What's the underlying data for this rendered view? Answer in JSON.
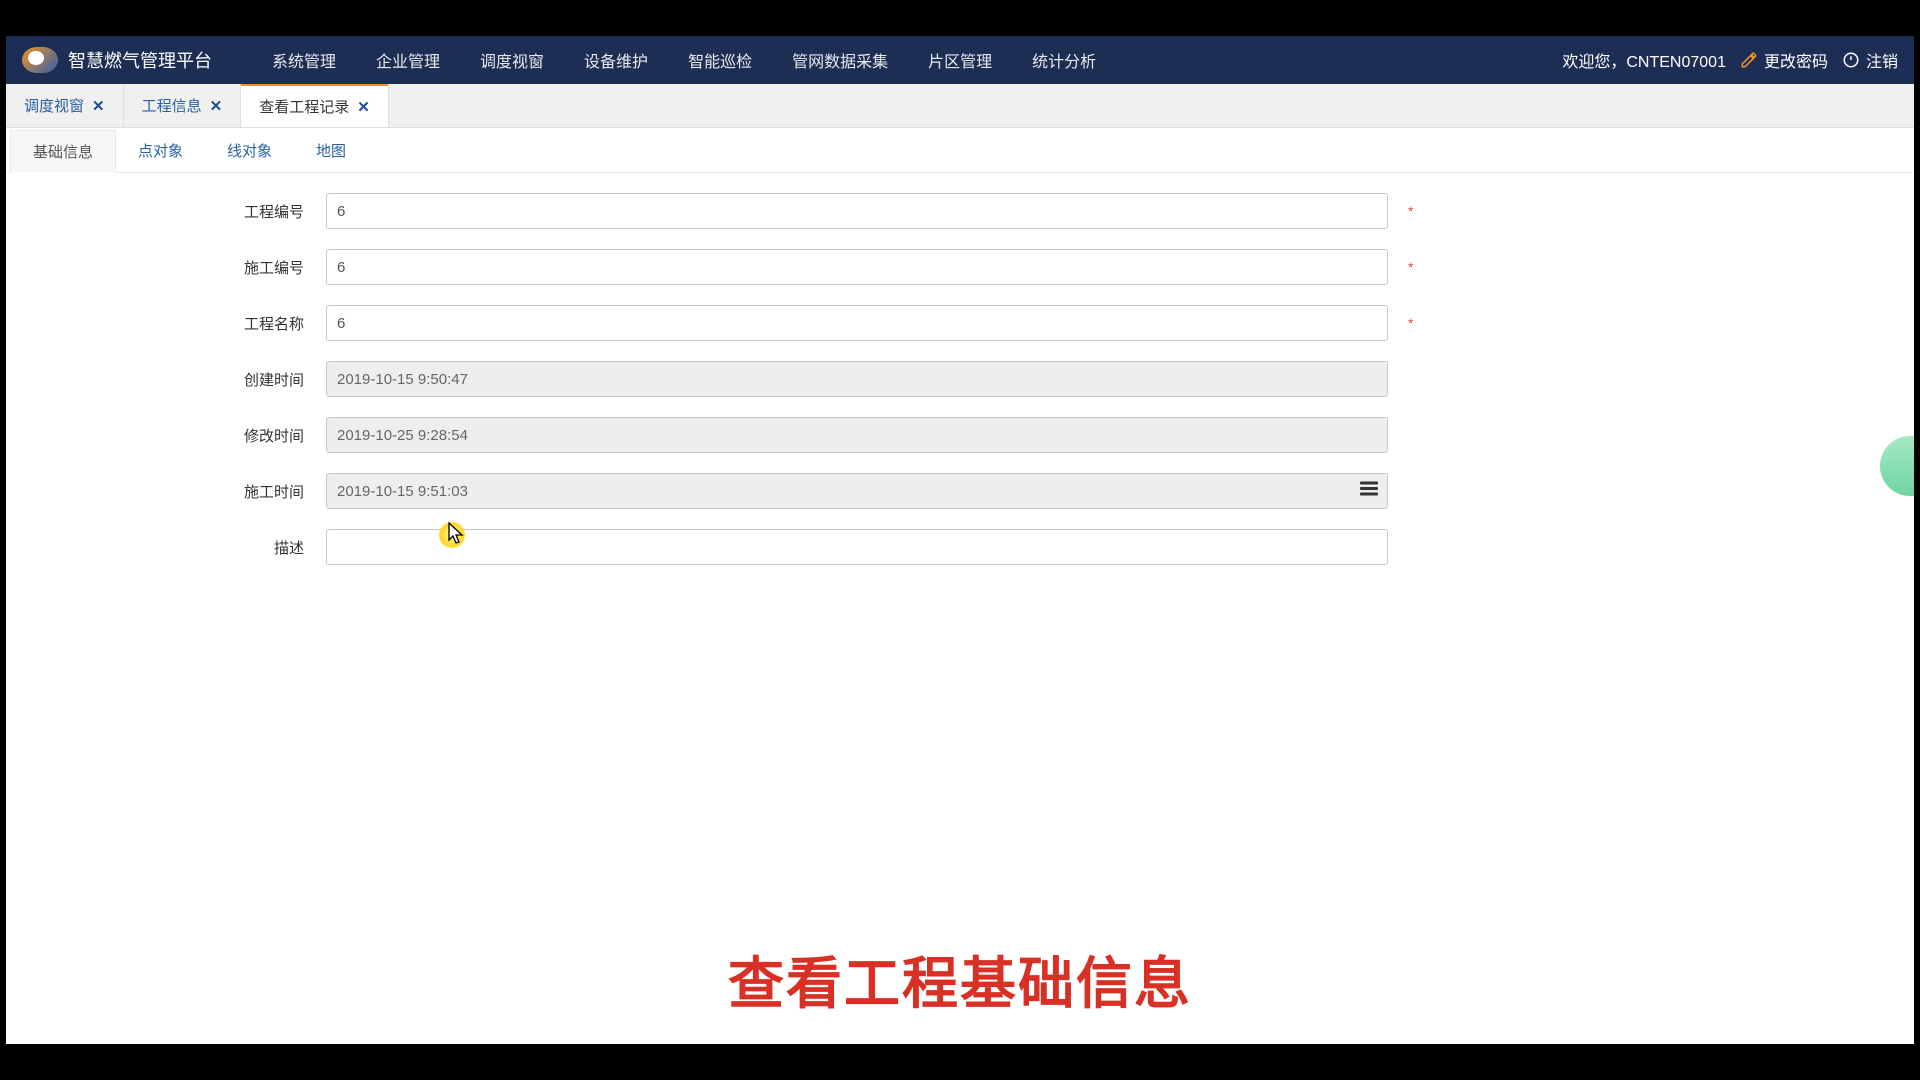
{
  "header": {
    "app_title": "智慧燃气管理平台",
    "nav": [
      "系统管理",
      "企业管理",
      "调度视窗",
      "设备维护",
      "智能巡检",
      "管网数据采集",
      "片区管理",
      "统计分析"
    ],
    "welcome": "欢迎您，CNTEN07001",
    "change_pwd": "更改密码",
    "logout": "注销"
  },
  "main_tabs": [
    {
      "label": "调度视窗",
      "active": false
    },
    {
      "label": "工程信息",
      "active": false
    },
    {
      "label": "查看工程记录",
      "active": true
    }
  ],
  "sub_tabs": [
    {
      "label": "基础信息",
      "active": true
    },
    {
      "label": "点对象",
      "active": false
    },
    {
      "label": "线对象",
      "active": false
    },
    {
      "label": "地图",
      "active": false
    }
  ],
  "form": {
    "project_code": {
      "label": "工程编号",
      "value": "6",
      "required": true
    },
    "work_code": {
      "label": "施工编号",
      "value": "6",
      "required": true
    },
    "project_name": {
      "label": "工程名称",
      "value": "6",
      "required": true
    },
    "created": {
      "label": "创建时间",
      "value": "2019-10-15 9:50:47"
    },
    "modified": {
      "label": "修改时间",
      "value": "2019-10-25 9:28:54"
    },
    "work_time": {
      "label": "施工时间",
      "value": "2019-10-15 9:51:03"
    },
    "desc": {
      "label": "描述",
      "value": ""
    }
  },
  "caption": "查看工程基础信息"
}
